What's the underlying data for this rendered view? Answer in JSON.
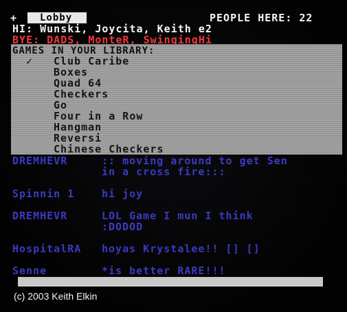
{
  "header": {
    "plus": "+",
    "lobby_tab": "Lobby",
    "people_label": "PEOPLE HERE:",
    "people_count": "22"
  },
  "status": {
    "hi": "HI:  Wunski, Joycita, Keith e2",
    "bye": "BYE: DADS, MonteR, SwingingHi"
  },
  "games_menu": {
    "title": "GAMES IN YOUR LIBRARY:",
    "selected_index": 0,
    "items": [
      {
        "label": "Club Caribe",
        "check": "✓"
      },
      {
        "label": "Boxes",
        "check": ""
      },
      {
        "label": "Quad 64",
        "check": ""
      },
      {
        "label": "Checkers",
        "check": ""
      },
      {
        "label": "Go",
        "check": ""
      },
      {
        "label": "Four in a Row",
        "check": ""
      },
      {
        "label": "Hangman",
        "check": ""
      },
      {
        "label": "Reversi",
        "check": ""
      },
      {
        "label": "Chinese Checkers",
        "check": ""
      }
    ]
  },
  "chat": {
    "messages": [
      {
        "name": "DREMHEVR",
        "line1": ":: moving around to get Sen",
        "line2": "in a cross fire:::"
      },
      {
        "name": "Spinnin 1",
        "line1": "hi joy",
        "line2": ""
      },
      {
        "name": "DREMHEVR",
        "line1": "LOL Game  I mun I think",
        "line2": ":DODOD"
      },
      {
        "name": "HospitalRA",
        "line1": "hoyas Krystalee!! [] []",
        "line2": ""
      },
      {
        "name": "Senne",
        "line1": "*is better RARE!!!",
        "line2": ""
      }
    ]
  },
  "input": {
    "value": ""
  },
  "footer": {
    "copyright": "(c) 2003 Keith Elkin"
  },
  "colors": {
    "background": "#050505",
    "menu_bg": "#a3a3a3",
    "chat_text": "#3d3dcc",
    "bye_text": "#ff3a3a",
    "tab_bg": "#f2f2f2"
  }
}
